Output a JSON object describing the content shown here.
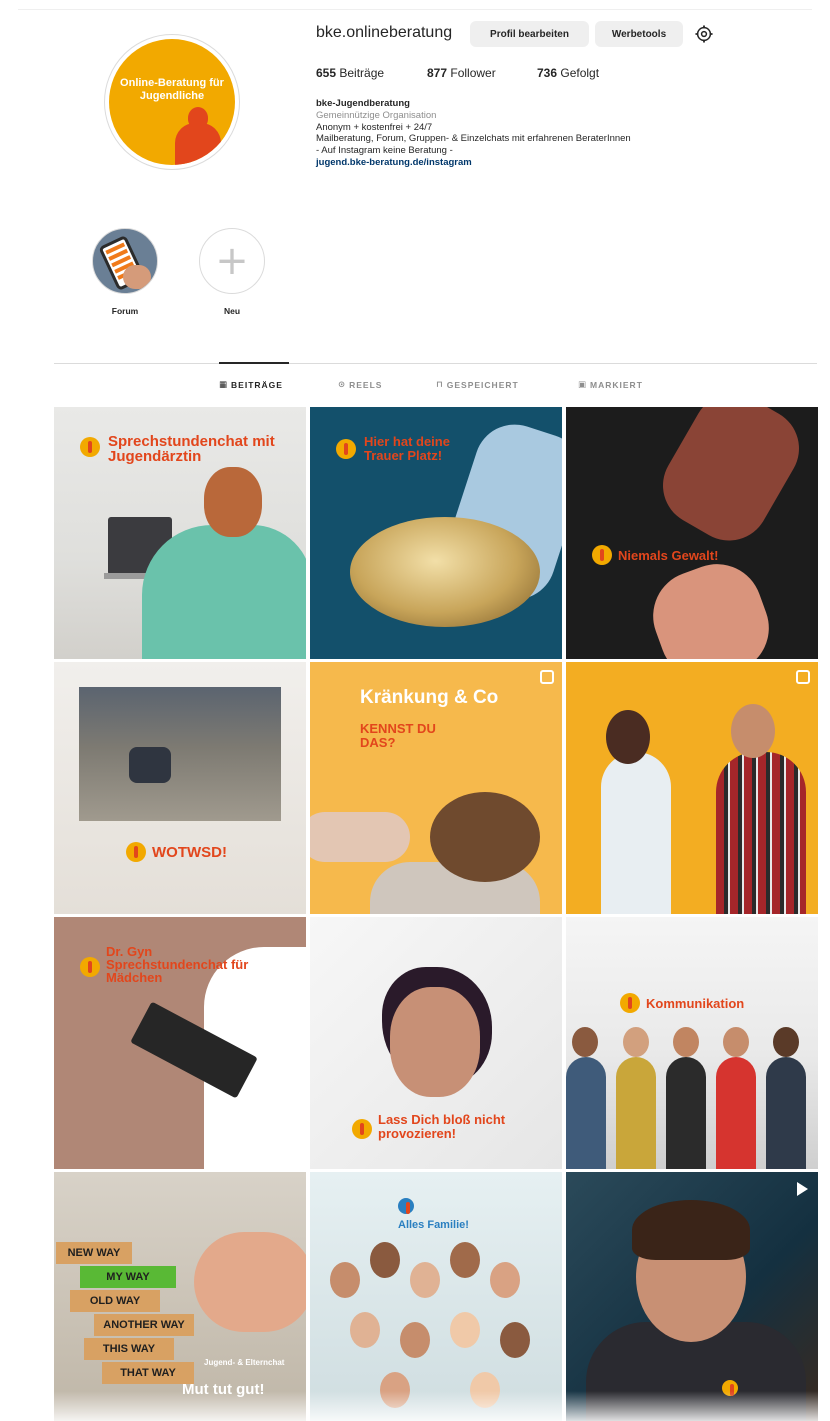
{
  "profile": {
    "username": "bke.onlineberatung",
    "avatar_text": "Online-Beratung für Jugendliche",
    "edit_button": "Profil bearbeiten",
    "tools_button": "Werbetools",
    "settings_icon": "gear-icon"
  },
  "stats": {
    "posts_count": "655",
    "posts_label": "Beiträge",
    "followers_count": "877",
    "followers_label": "Follower",
    "following_count": "736",
    "following_label": "Gefolgt"
  },
  "bio": {
    "name": "bke-Jugendberatung",
    "category": "Gemeinnützige Organisation",
    "line1": "Anonym + kostenfrei + 24/7",
    "line2": "Mailberatung, Forum, Gruppen- & Einzelchats mit erfahrenen BeraterInnen",
    "line3": "- Auf Instagram keine Beratung -",
    "link": "jugend.bke-beratung.de/instagram"
  },
  "highlights": [
    {
      "label": "Forum"
    },
    {
      "label": "Neu"
    }
  ],
  "tabs": [
    {
      "label": "BEITRÄGE",
      "icon": "grid-icon"
    },
    {
      "label": "REELS",
      "icon": "reels-icon"
    },
    {
      "label": "GESPEICHERT",
      "icon": "bookmark-icon"
    },
    {
      "label": "MARKIERT",
      "icon": "tag-icon"
    }
  ],
  "posts": [
    {
      "caption": "Sprechstundenchat mit Jugendärztin"
    },
    {
      "caption": "Hier hat deine Trauer Platz!"
    },
    {
      "caption": "Niemals Gewalt!"
    },
    {
      "caption": "WOTWSD!"
    },
    {
      "caption": "Kränkung & Co",
      "caption2": "KENNST DU DAS?"
    },
    {
      "caption": ""
    },
    {
      "caption": "Dr. Gyn Sprechstundenchat für Mädchen"
    },
    {
      "caption": "Lass Dich bloß nicht provozieren!"
    },
    {
      "caption": "Kommunikation"
    },
    {
      "caption": "Mut tut gut!",
      "blocks": [
        "NEW WAY",
        "MY WAY",
        "OLD WAY",
        "ANOTHER WAY",
        "THIS WAY",
        "THAT WAY"
      ],
      "badge": "Jugend- & Elternchat"
    },
    {
      "caption": "Alles Familie!"
    },
    {
      "caption": ""
    }
  ],
  "colors": {
    "brand_orange": "#f2a900",
    "brand_red": "#e2461c",
    "link_blue": "#00376b"
  }
}
